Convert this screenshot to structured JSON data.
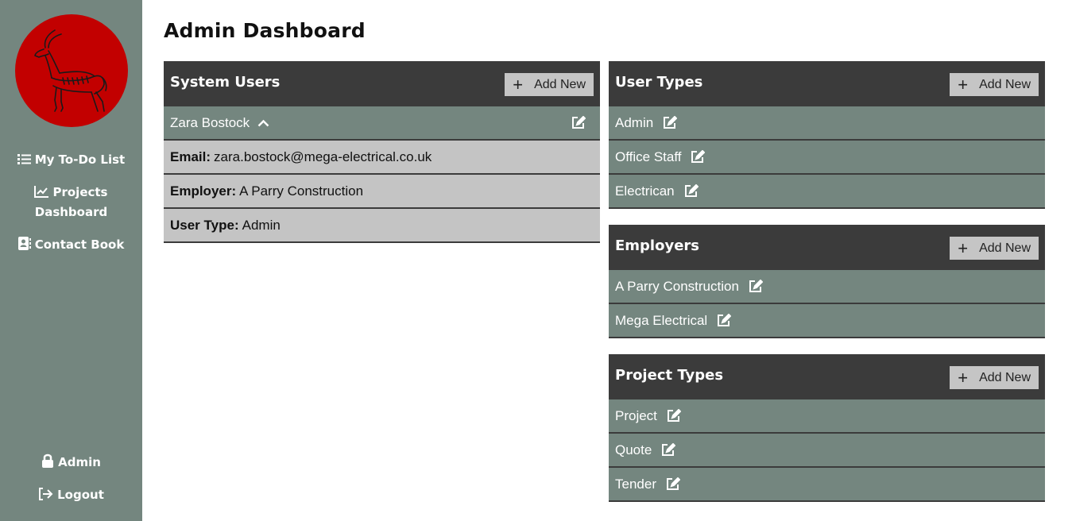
{
  "sidebar": {
    "logo_icon": "antelope-logo",
    "nav": [
      {
        "label": "My To-Do List",
        "icon": "list-icon"
      },
      {
        "label": "Projects",
        "label2": "Dashboard",
        "icon": "chart-line-icon"
      },
      {
        "label": "Contact Book",
        "icon": "address-book-icon"
      }
    ],
    "bottom": [
      {
        "label": "Admin",
        "icon": "lock-icon"
      },
      {
        "label": "Logout",
        "icon": "logout-icon"
      }
    ]
  },
  "page": {
    "title": "Admin Dashboard"
  },
  "add_label": "Add New",
  "system_users": {
    "title": "System Users",
    "selected_user": "Zara Bostock",
    "details": [
      {
        "label": "Email:",
        "value": "zara.bostock@mega-electrical.co.uk"
      },
      {
        "label": "Employer:",
        "value": "A Parry Construction"
      },
      {
        "label": "User Type:",
        "value": "Admin"
      }
    ]
  },
  "user_types": {
    "title": "User Types",
    "items": [
      "Admin",
      "Office Staff",
      "Electrican"
    ]
  },
  "employers": {
    "title": "Employers",
    "items": [
      "A Parry Construction",
      "Mega Electrical"
    ]
  },
  "project_types": {
    "title": "Project Types",
    "items": [
      "Project",
      "Quote",
      "Tender"
    ]
  },
  "colors": {
    "sidebar": "#74867f",
    "header": "#3b3b3b",
    "row": "#74867f",
    "detail_row": "#c4c4c4",
    "logo": "#c20000"
  }
}
